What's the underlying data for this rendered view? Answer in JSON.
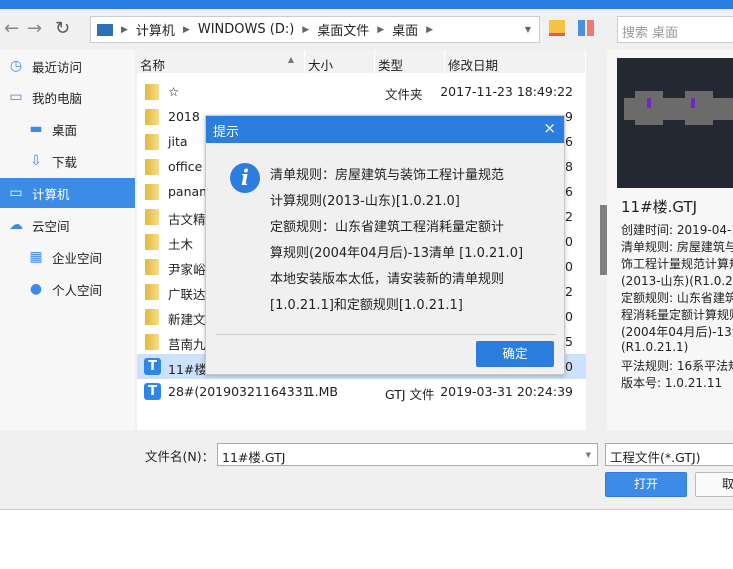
{
  "toolbar": {
    "back": "←",
    "forward": "→",
    "refresh": "↻",
    "breadcrumb": [
      "计算机",
      "WINDOWS (D:)",
      "桌面文件",
      "桌面"
    ],
    "search_placeholder": "搜索 桌面"
  },
  "sidebar": {
    "items": [
      {
        "label": "最近访问",
        "icon": "clock-icon",
        "glyph": "◷"
      },
      {
        "label": "我的电脑",
        "icon": "monitor-icon",
        "glyph": "▭"
      },
      {
        "label": "桌面",
        "icon": "desktop-icon",
        "glyph": "▬"
      },
      {
        "label": "下载",
        "icon": "download-icon",
        "glyph": "⇩"
      },
      {
        "label": "计算机",
        "icon": "computer-icon",
        "glyph": "▭",
        "selected": true
      },
      {
        "label": "云空间",
        "icon": "cloud-icon",
        "glyph": "☁"
      },
      {
        "label": "企业空间",
        "icon": "building-icon",
        "glyph": "▦"
      },
      {
        "label": "个人空间",
        "icon": "person-icon",
        "glyph": "●"
      }
    ]
  },
  "list": {
    "headers": [
      "名称",
      "大小",
      "类型",
      "修改日期"
    ],
    "rows": [
      {
        "name": "☆",
        "size": "",
        "type": "文件夹",
        "date": "2017-11-23 18:49:22",
        "kind": "folder"
      },
      {
        "name": "2018",
        "size": "",
        "type": "",
        "date": "9",
        "kind": "folder"
      },
      {
        "name": "jita",
        "size": "",
        "type": "",
        "date": "6",
        "kind": "folder"
      },
      {
        "name": "office",
        "size": "",
        "type": "",
        "date": "8",
        "kind": "folder"
      },
      {
        "name": "panam",
        "size": "",
        "type": "",
        "date": "6",
        "kind": "folder"
      },
      {
        "name": "古文精",
        "size": "",
        "type": "",
        "date": "2",
        "kind": "folder"
      },
      {
        "name": "土木",
        "size": "",
        "type": "",
        "date": "0",
        "kind": "folder"
      },
      {
        "name": "尹家峪",
        "size": "",
        "type": "",
        "date": "0",
        "kind": "folder"
      },
      {
        "name": "广联达",
        "size": "",
        "type": "",
        "date": "2",
        "kind": "folder"
      },
      {
        "name": "新建文",
        "size": "",
        "type": "",
        "date": "0",
        "kind": "folder"
      },
      {
        "name": "莒南九",
        "size": "",
        "type": "",
        "date": "5",
        "kind": "folder"
      },
      {
        "name": "11#楼.",
        "size": "",
        "type": "",
        "date": "0",
        "kind": "gtj",
        "selected": true
      },
      {
        "name": "28#(20190321164331...",
        "size": "1 MB",
        "type": "GTJ 文件",
        "date": "2019-03-31 20:24:39",
        "kind": "gtj"
      }
    ]
  },
  "preview": {
    "title": "11#楼.GTJ",
    "lines": [
      "创建时间: 2019-04-1",
      "清单规则: 房屋建筑与",
      "饰工程计量规范计算规",
      "(2013-山东)(R1.0.21.",
      "定额规则: 山东省建筑",
      "程消耗量定额计算规则",
      "(2004年04月后)-13清",
      "(R1.0.21.1)",
      "平法规则: 16系平法规",
      "版本号: 1.0.21.11"
    ]
  },
  "bottom": {
    "filename_label": "文件名(N)：",
    "filename": "11#楼.GTJ",
    "filetype": "工程文件(*.GTJ)",
    "open": "打开",
    "cancel": "取"
  },
  "dialog": {
    "title": "提示",
    "close": "×",
    "messages": [
      "清单规则：房屋建筑与装饰工程计量规范",
      "计算规则(2013-山东)[1.0.21.0]",
      "定额规则：山东省建筑工程消耗量定额计",
      "算规则(2004年04月后)-13清单 [1.0.21.0]",
      "本地安装版本太低，请安装新的清单规则",
      "[1.0.21.1]和定额规则[1.0.21.1]"
    ],
    "ok": "确定"
  },
  "colors": {
    "accent": "#2b7de0",
    "selection": "#cce1fb"
  }
}
